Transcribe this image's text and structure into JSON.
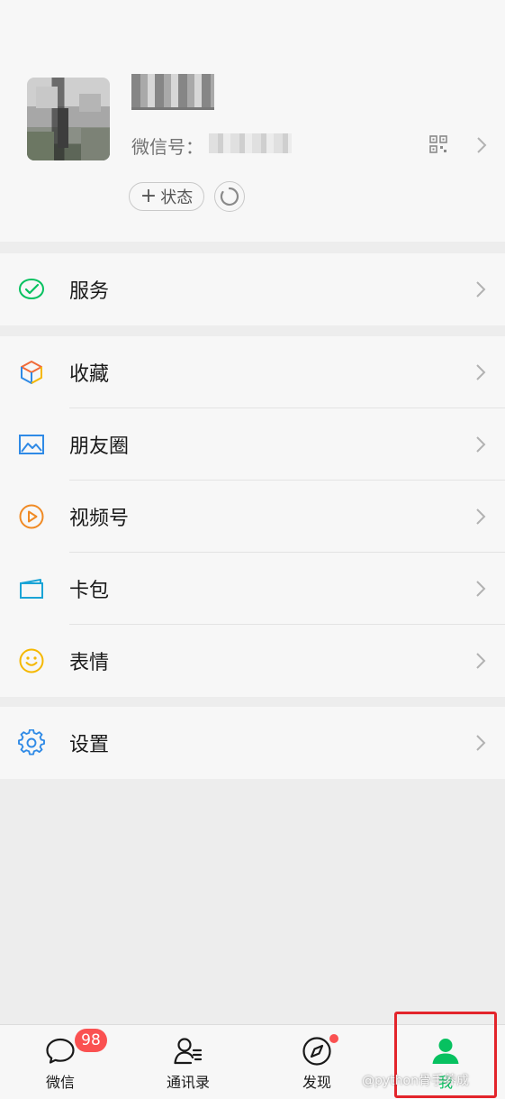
{
  "profile": {
    "wxid_label": "微信号：",
    "status_button": "状态",
    "status_plus": "+"
  },
  "menu": {
    "services": "服务",
    "favorites": "收藏",
    "moments": "朋友圈",
    "channels": "视频号",
    "cards": "卡包",
    "stickers": "表情",
    "settings": "设置"
  },
  "tabbar": {
    "chats": "微信",
    "chats_badge": "98",
    "contacts": "通讯录",
    "discover": "发现",
    "me": "我"
  },
  "watermark": "@python骨手养成",
  "colors": {
    "brand_green": "#07c160",
    "badge_red": "#fa5151",
    "highlight_red": "#e3242b"
  }
}
